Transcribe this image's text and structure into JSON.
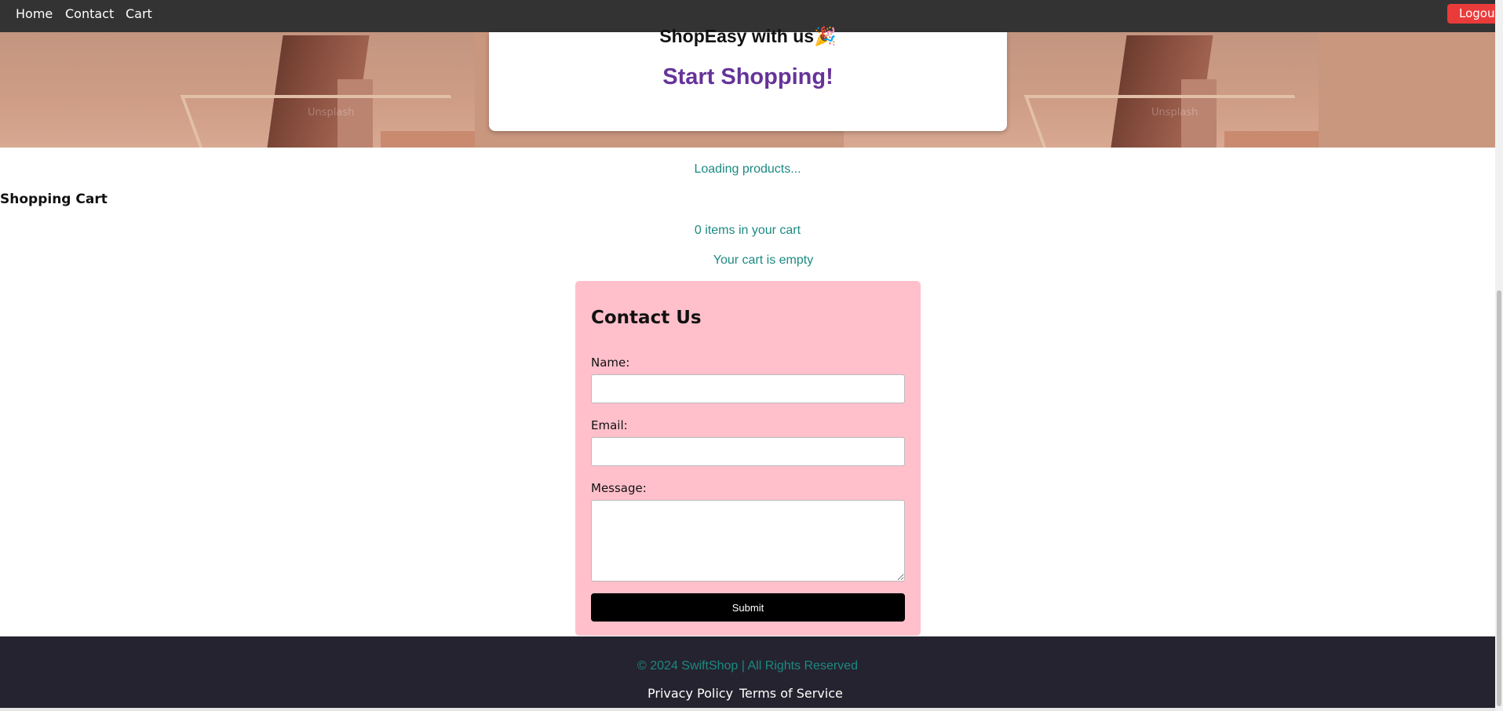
{
  "nav": {
    "items": [
      {
        "label": "Home"
      },
      {
        "label": "Contact"
      },
      {
        "label": "Cart"
      }
    ],
    "logout_label": "Logout"
  },
  "hero": {
    "title": "ShopEasy with us🎉",
    "cta": "Start Shopping!",
    "watermark": "Unsplash"
  },
  "products": {
    "status": "Loading products..."
  },
  "cart": {
    "heading": "Shopping Cart",
    "count_text": "0 items in your cart",
    "empty_text": "Your cart is empty"
  },
  "contact": {
    "heading": "Contact Us",
    "name_label": "Name:",
    "name_value": "",
    "email_label": "Email:",
    "email_value": "",
    "message_label": "Message:",
    "message_value": "",
    "submit_label": "Submit"
  },
  "footer": {
    "copyright": "© 2024 SwiftShop | All Rights Reserved",
    "links": [
      {
        "label": "Privacy Policy"
      },
      {
        "label": "Terms of Service"
      }
    ]
  },
  "colors": {
    "nav_bg": "#333333",
    "logout_bg": "#ea3b3b",
    "cta": "#663399",
    "teal_text": "#1c8a82",
    "contact_bg": "#ffc0cb",
    "footer_bg": "#24232f"
  }
}
